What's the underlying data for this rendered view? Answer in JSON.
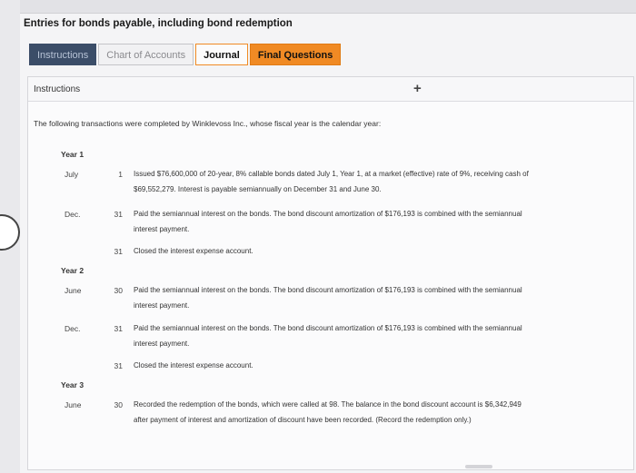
{
  "title": "Entries for bonds payable, including bond redemption",
  "tabs": [
    {
      "label": "Instructions"
    },
    {
      "label": "Chart of Accounts"
    },
    {
      "label": "Journal"
    },
    {
      "label": "Final Questions"
    }
  ],
  "panel": {
    "heading": "Instructions",
    "plus_icon": "+",
    "intro": "The following transactions were completed by Winklevoss Inc., whose fiscal year is the calendar year:"
  },
  "transactions": {
    "year1": "Year 1",
    "y1_month1": "July",
    "y1_day1": "1",
    "y1_desc1": "Issued $76,600,000 of 20-year, 8% callable bonds dated July 1, Year 1, at a market (effective) rate of 9%, receiving cash of $69,552,279. Interest is payable semiannually on December 31 and June 30.",
    "y1_month2": "Dec.",
    "y1_day2": "31",
    "y1_desc2": "Paid the semiannual interest on the bonds. The bond discount amortization of $176,193 is combined with the semiannual interest payment.",
    "y1_day3": "31",
    "y1_desc3": "Closed the interest expense account.",
    "year2": "Year 2",
    "y2_month1": "June",
    "y2_day1": "30",
    "y2_desc1": "Paid the semiannual interest on the bonds. The bond discount amortization of $176,193 is combined with the semiannual interest payment.",
    "y2_month2": "Dec.",
    "y2_day2": "31",
    "y2_desc2": "Paid the semiannual interest on the bonds. The bond discount amortization of $176,193 is combined with the semiannual interest payment.",
    "y2_day3": "31",
    "y2_desc3": "Closed the interest expense account.",
    "year3": "Year 3",
    "y3_month1": "June",
    "y3_day1": "30",
    "y3_desc1": "Recorded the redemption of the bonds, which were called at 98. The balance in the bond discount account is $6,342,949 after payment of interest and amortization of discount have been recorded. (Record the redemption only.)"
  }
}
